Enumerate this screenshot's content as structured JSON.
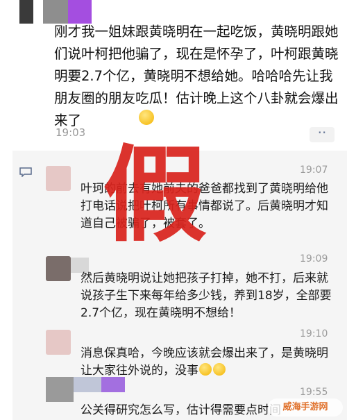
{
  "post": {
    "text": "刚才我一姐妹跟黄晓明在一起吃饭，黄晓明跟她们说叶柯把他骗了，现在是怀孕了，叶柯跟黄晓明要2.7个亿，黄晓明不想给她。哈哈哈先让我朋友圈的朋友吃瓜！估计晚上这个八卦就会爆出来了",
    "time": "19:03",
    "more_label": "··"
  },
  "overlay_text": "假",
  "comments": [
    {
      "time": "19:07",
      "text": "叶珂的前去有她前夫的爸爸都找到了黄晓明给他打电话说把叶柯所有事情都说了。后黄晓明才知道自己被骗了，被套了。"
    },
    {
      "time": "19:09",
      "text": "然后黄晓明说让她把孩子打掉，她不打，后来就说孩子生下来每年给多少钱，养到18岁，全部要2.7个亿，现在黄晓明不想给！"
    },
    {
      "time": "19:10",
      "text": "消息保真哈，今晚应该就会爆出来了，是黄晓明让大家往外说的，没事"
    },
    {
      "time": "19:55",
      "text": "公关得研究怎么写，估计得需要点时间"
    }
  ],
  "watermark": "威海手游网",
  "colors": {
    "overlay": "#d9231d",
    "avatar_pink": "#e8c4c4",
    "avatar_purple": "#8a4bd8",
    "comment_bg": "#f5f5f5"
  }
}
